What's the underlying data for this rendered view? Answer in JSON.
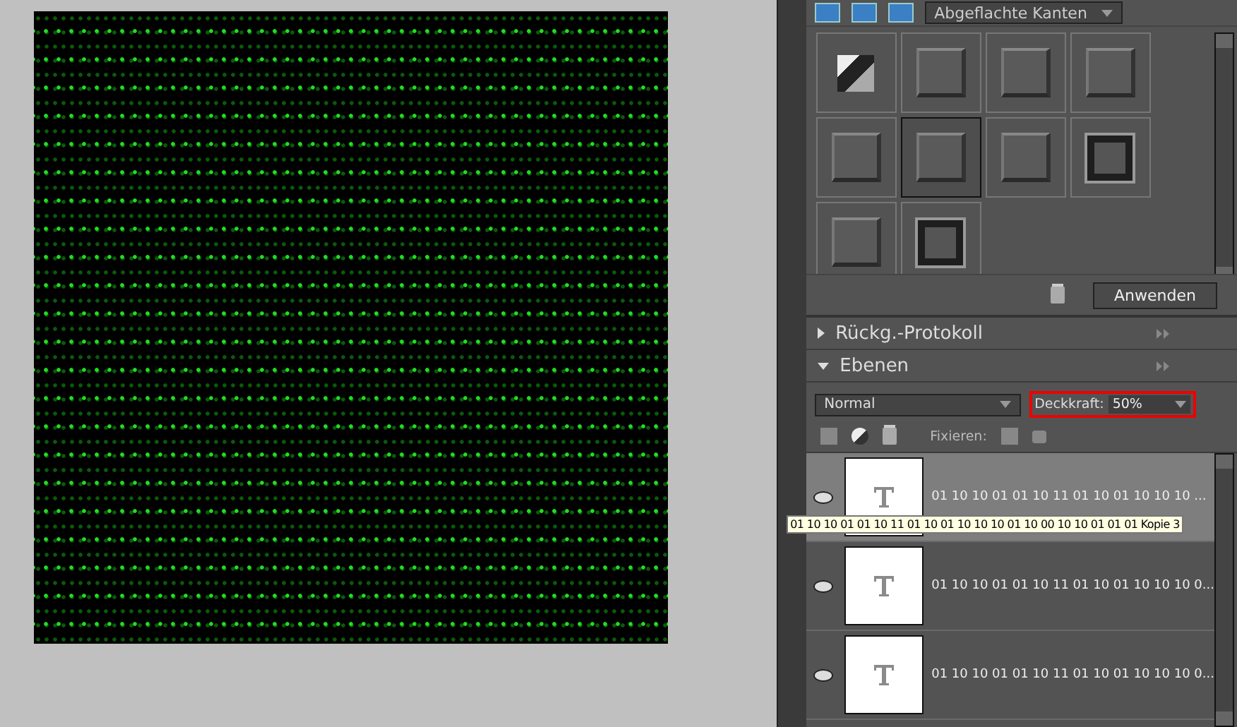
{
  "style_toolbar": {
    "style_category": "Abgeflachte Kanten"
  },
  "styles": [
    {
      "kind": "photo",
      "selected": false
    },
    {
      "kind": "bevel",
      "selected": false
    },
    {
      "kind": "bevel",
      "selected": false
    },
    {
      "kind": "bevel",
      "selected": false
    },
    {
      "kind": "bevel",
      "selected": false
    },
    {
      "kind": "bevel",
      "selected": true
    },
    {
      "kind": "bevel",
      "selected": false
    },
    {
      "kind": "frame",
      "selected": false
    },
    {
      "kind": "bevel",
      "selected": false
    },
    {
      "kind": "frame",
      "selected": false
    }
  ],
  "apply_button": "Anwenden",
  "panels": [
    {
      "title": "Rückg.-Protokoll",
      "expanded": false
    },
    {
      "title": "Ebenen",
      "expanded": true
    }
  ],
  "layers_panel": {
    "blend_mode": "Normal",
    "opacity_label": "Deckkraft:",
    "opacity": "50%",
    "lock_label": "Fixieren:",
    "layers": [
      {
        "name": "01 10 10 01 01 10 11 01 10 01 10 10 10 ...",
        "visible": true,
        "selected": true
      },
      {
        "name": "01 10 10 01 01 10 11 01 10 01 10 10 10 0...",
        "visible": true,
        "selected": false
      },
      {
        "name": "01 10 10 01 01 10 11 01 10 01 10 10 10 0...",
        "visible": true,
        "selected": false
      }
    ],
    "tooltip": "01 10 10 01 01 10 11 01 10 01 10 10 10 01 10 00 10 10 01 01 01 Kopie 3"
  }
}
